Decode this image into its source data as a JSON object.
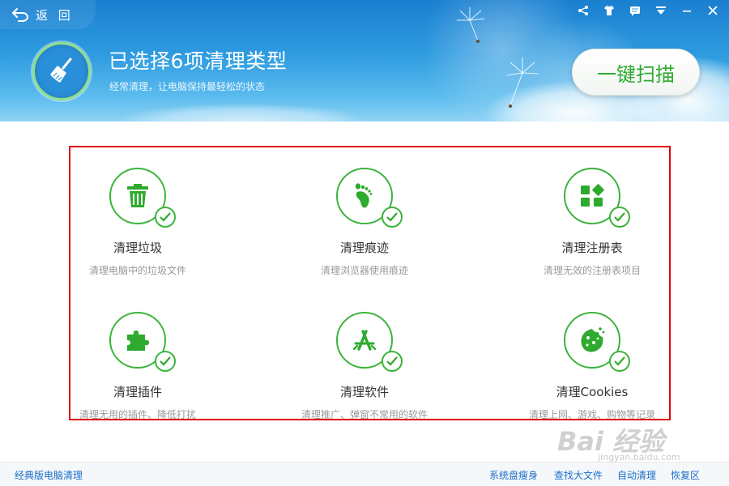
{
  "header": {
    "back_label": "返 回",
    "title": "已选择6项清理类型",
    "subtitle": "经常清理，让电脑保持最轻松的状态",
    "scan_button": "一键扫描"
  },
  "items": [
    {
      "title": "清理垃圾",
      "desc": "清理电脑中的垃圾文件",
      "icon": "trash-icon",
      "checked": true
    },
    {
      "title": "清理痕迹",
      "desc": "清理浏览器使用痕迹",
      "icon": "footprint-icon",
      "checked": true
    },
    {
      "title": "清理注册表",
      "desc": "清理无效的注册表项目",
      "icon": "registry-icon",
      "checked": true
    },
    {
      "title": "清理插件",
      "desc": "清理无用的插件、降低打扰",
      "icon": "puzzle-icon",
      "checked": true
    },
    {
      "title": "清理软件",
      "desc": "清理推广、弹窗不常用的软件",
      "icon": "appstore-icon",
      "checked": true
    },
    {
      "title": "清理Cookies",
      "desc": "清理上网、游戏、购物等记录",
      "icon": "cookie-icon",
      "checked": true
    }
  ],
  "footer": {
    "left_link": "经典版电脑清理",
    "links": [
      "系统盘瘦身",
      "查找大文件",
      "自动清理",
      "恢复区"
    ]
  },
  "watermark": {
    "main": "Bai 经验",
    "sub": "jingyan.baidu.com"
  },
  "colors": {
    "accent_green": "#3cb43c",
    "header_blue": "#2e9be0",
    "highlight_red": "#e00000",
    "link_blue": "#1a6dc7"
  }
}
